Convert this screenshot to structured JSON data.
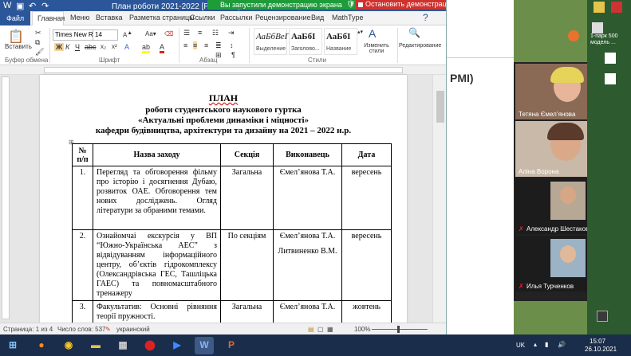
{
  "window": {
    "title": "План роботи 2021-2022 [Режим огран",
    "share_message": "Вы запустили демонстрацию экрана",
    "stop_share_label": "Остановить демонстрацию"
  },
  "ribbon_tabs": [
    "Файл",
    "Главная",
    "Меню",
    "Вставка",
    "Разметка страницы",
    "Ссылки",
    "Рассылки",
    "Рецензирование",
    "Вид",
    "MathType"
  ],
  "ribbon": {
    "paste_label": "Вставить",
    "clipboard_group": "Буфер обмена",
    "font_name": "Times New Rc",
    "font_size": "14",
    "font_group": "Шрифт",
    "paragraph_group": "Абзац",
    "styles_group": "Стили",
    "styles": [
      {
        "sample": "АаБбВеГ",
        "name": "Выделение"
      },
      {
        "sample": "АаБбI",
        "name": "Заголово..."
      },
      {
        "sample": "АаБбI",
        "name": "Название"
      }
    ],
    "change_styles_label": "Изменить стили",
    "editing_label": "Редактирование"
  },
  "document": {
    "heading": "ПЛАН",
    "subheading1": "роботи студентського наукового гуртка",
    "subheading2": "«Актуальні проблеми динаміки і міцності»",
    "subheading3": "кафедри будівництва, архітектури та дизайну на 2021 – 2022 н.р.",
    "table_headers": [
      "№ п/п",
      "Назва заходу",
      "Секція",
      "Виконавець",
      "Дата"
    ],
    "rows": [
      {
        "num": "1.",
        "name": "Перегляд та обговорення фільму про історію і досягнення Дубаю, розвиток ОАЕ. Обговорення тем нових досліджень. Огляд літератури за обраними темами.",
        "section": "Загальна",
        "executor": "Ємел’янова Т.А.",
        "executor2": "",
        "date": "вересень"
      },
      {
        "num": "2.",
        "name": "Ознайомчаі екскурсія у ВП “Южно-Українська АЕС” з відвідуванням інформаційного центру, об’єктів гідрокомплексу (Олександрівська ГЕС, Ташліцька ГАЕС) та повномасштабного тренажеру",
        "section": "По секціям",
        "executor": "Ємел’янова Т.А.",
        "executor2": "Литвиненко В.М.",
        "date": "вересень"
      },
      {
        "num": "3.",
        "name": "Факультатив: Основні рівняння теорії пружності.",
        "section": "Загальна",
        "executor": "Ємел’янова Т.А.",
        "executor2": "",
        "date": "жовтень"
      }
    ]
  },
  "status": {
    "page": "Страница: 1 из 4",
    "words": "Число слов: 537",
    "language": "украинский",
    "zoom": "100%"
  },
  "meeting": {
    "slide_text": "PMI)",
    "participants": [
      {
        "name": "Тетяна Ємел’янова",
        "muted": false
      },
      {
        "name": "Аліна Ворона",
        "muted": false
      },
      {
        "name": "Александр Шестаков",
        "muted": true
      },
      {
        "name": "Илья Турченков",
        "muted": true
      }
    ]
  },
  "desktop": {
    "labels": [
      "1-парк 500",
      "модель ..."
    ]
  },
  "tray": {
    "lang": "UK",
    "time": "15:07",
    "date": "26.10.2021"
  },
  "colors": {
    "word_blue": "#2b579a",
    "share_green": "#1e9c3a",
    "stop_red": "#d0312d",
    "taskbar": "#1a2d4a"
  }
}
